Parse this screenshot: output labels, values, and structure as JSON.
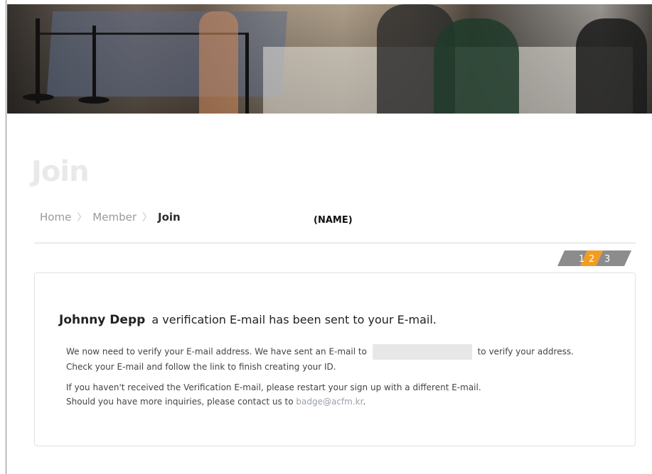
{
  "page": {
    "title": "Join"
  },
  "breadcrumb": {
    "items": [
      "Home",
      "Member"
    ],
    "current": "Join"
  },
  "name_tag": "(NAME)",
  "steps": {
    "labels": [
      "1",
      "2",
      "3"
    ],
    "active": "2",
    "active_color": "#f39c1f",
    "inactive_color": "#8c8c8c"
  },
  "message": {
    "user_name": "Johnny Depp",
    "headline": "a verification E-mail has been sent to your E-mail.",
    "line1_before": "We now need to verify your E-mail address. We have sent an E-mail to",
    "line1_after": "to verify your address.",
    "line2": "Check your E-mail and follow the link to finish creating your ID.",
    "line3": "If you haven't received the Verification E-mail, please restart your sign up with a different E-mail.",
    "line4_before": "Should you have more inquiries, please contact us to",
    "contact_email": "badge@acfm.kr",
    "line4_after": "."
  }
}
